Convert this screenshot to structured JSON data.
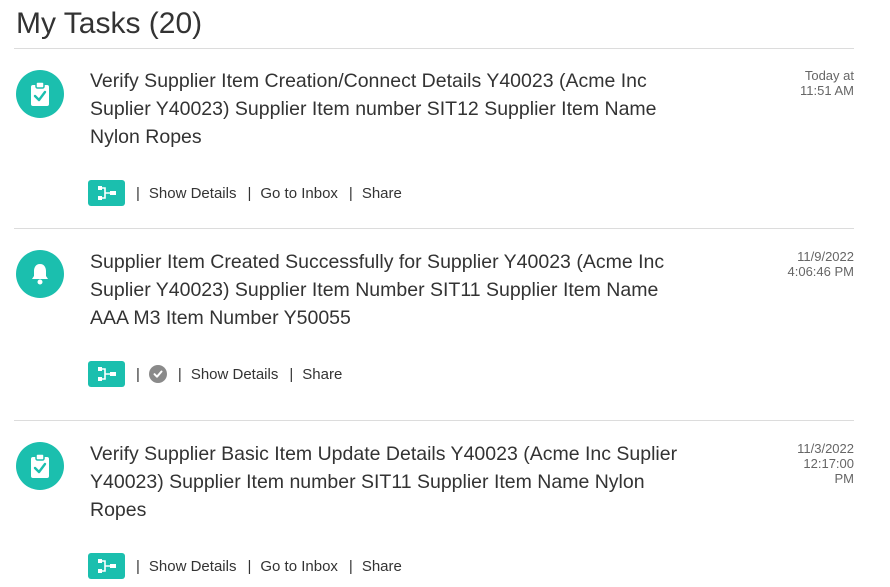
{
  "header": {
    "title": "My Tasks (20)"
  },
  "tasks": [
    {
      "icon": "clipboard-check-icon",
      "text": "Verify Supplier Item Creation/Connect Details Y40023 (Acme Inc Suplier Y40023) Supplier Item number SIT12 Supplier Item Name Nylon Ropes",
      "time_line1": "Today at",
      "time_line2": "11:51 AM",
      "time_line3": "",
      "actions": {
        "show_details": "Show Details",
        "go_to_inbox": "Go to Inbox",
        "share": "Share"
      }
    },
    {
      "icon": "bell-icon",
      "text": "Supplier Item Created Successfully for Supplier Y40023 (Acme Inc Suplier Y40023) Supplier Item Number SIT11 Supplier Item Name AAA M3 Item Number Y50055",
      "time_line1": "11/9/2022",
      "time_line2": "4:06:46 PM",
      "time_line3": "",
      "actions": {
        "show_details": "Show Details",
        "share": "Share"
      }
    },
    {
      "icon": "clipboard-check-icon",
      "text": "Verify Supplier Basic Item Update Details Y40023 (Acme Inc Suplier Y40023) Supplier Item number SIT11 Supplier Item Name Nylon Ropes",
      "time_line1": "11/3/2022",
      "time_line2": "12:17:00",
      "time_line3": "PM",
      "actions": {
        "show_details": "Show Details",
        "go_to_inbox": "Go to Inbox",
        "share": "Share"
      }
    }
  ],
  "colors": {
    "accent": "#1bbfae",
    "divider": "#dcdcdc",
    "badge_gray": "#8a8a8a"
  }
}
